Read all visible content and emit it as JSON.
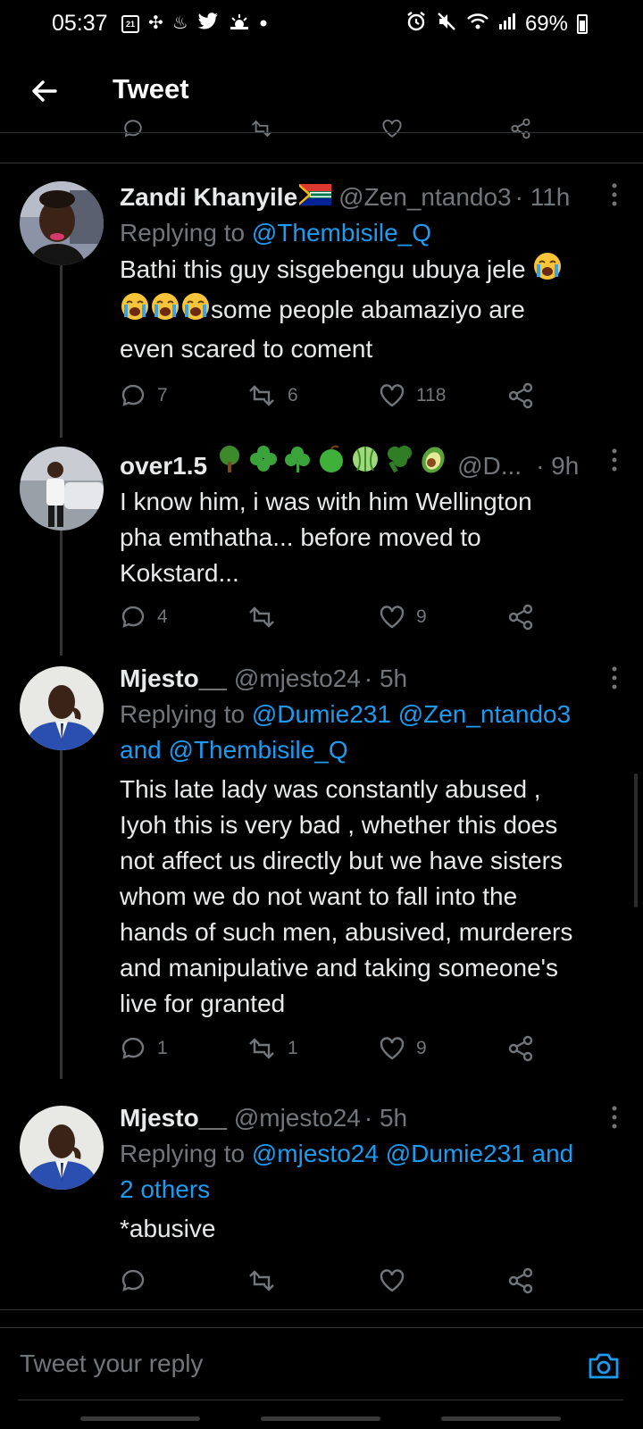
{
  "status_bar": {
    "time": "05:37",
    "calendar_day": "21",
    "battery": "69%"
  },
  "header": {
    "title": "Tweet"
  },
  "tweets": [
    {
      "name": "Zandi Khanyile",
      "handle": "@Zen_ntando3",
      "time": "· 11h",
      "replying_prefix": "Replying to ",
      "replying_to": "@Thembisile_Q",
      "body_line1": "Bathi this guy sisgebengu ubuya jele ",
      "body_line2": "some people abamaziyo are",
      "body_line3": "even scared to coment",
      "replies": "7",
      "retweets": "6",
      "likes": "118"
    },
    {
      "name": "over1.5",
      "handle": "@D...",
      "time": "· 9h",
      "body_line1": "I know him, i was with him Wellington",
      "body_line2": "pha emthatha... before moved to",
      "body_line3": "Kokstard...",
      "replies": "4",
      "retweets": "",
      "likes": "9"
    },
    {
      "name": "Mjesto__",
      "handle": "@mjesto24",
      "time": "· 5h",
      "replying_prefix": "Replying to ",
      "replying_to_1": "@Dumie231 @Zen_ntando3",
      "replying_to_2": "and @Thembisile_Q",
      "body_lines": [
        "This late lady was constantly abused ,",
        "Iyoh this is very bad , whether this does",
        "not affect us directly but we have sisters",
        "whom we do not want to fall into the",
        "hands of such men, abusived, murderers",
        "and manipulative and taking someone's",
        "live for granted"
      ],
      "replies": "1",
      "retweets": "1",
      "likes": "9"
    },
    {
      "name": "Mjesto__",
      "handle": "@mjesto24",
      "time": "· 5h",
      "replying_prefix": "Replying to ",
      "replying_to_1": "@mjesto24 @Dumie231 and",
      "replying_to_2": "2 others",
      "body_line1": "*abusive",
      "replies": "",
      "retweets": "",
      "likes": ""
    }
  ],
  "reply_bar": {
    "placeholder": "Tweet your reply"
  },
  "colors": {
    "background": "#000000",
    "text": "#e7e9ea",
    "muted": "#71767b",
    "link": "#1d9bf0",
    "divider": "#2f3336"
  }
}
